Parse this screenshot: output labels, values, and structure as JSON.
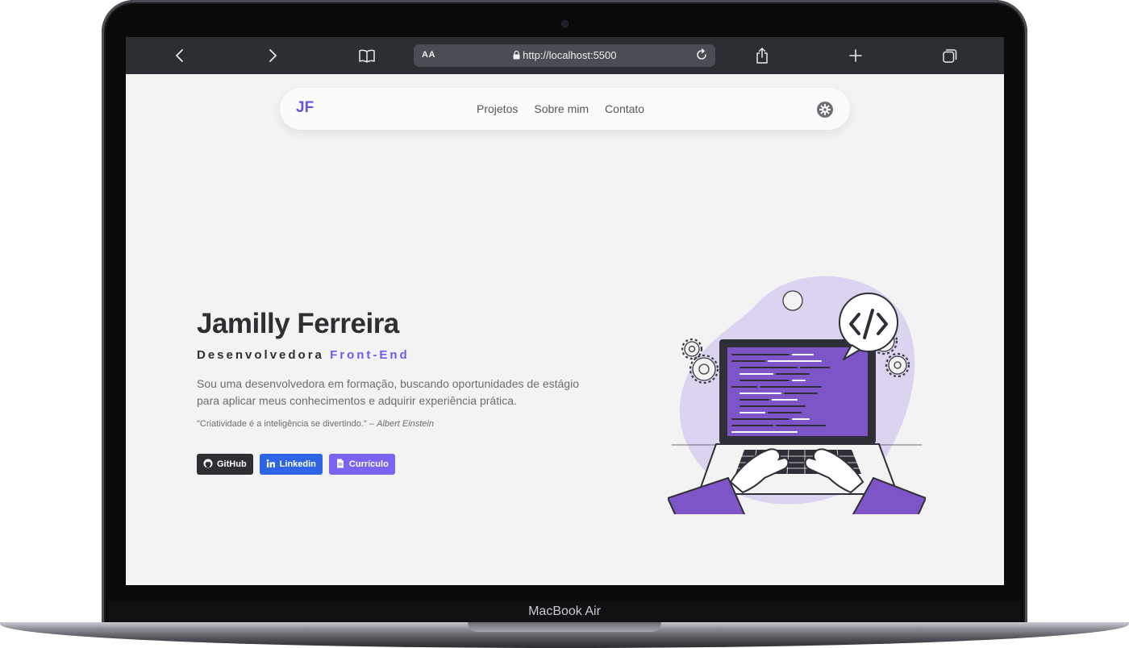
{
  "device": {
    "model_label": "MacBook Air"
  },
  "browser": {
    "text_size_label": "AA",
    "url": "http://localhost:5500",
    "icons": [
      "back-icon",
      "forward-icon",
      "bookmarks-icon",
      "lock-icon",
      "reload-icon",
      "share-icon",
      "new-tab-icon",
      "tabs-icon"
    ]
  },
  "nav": {
    "logo": "JF",
    "links": [
      {
        "label": "Projetos"
      },
      {
        "label": "Sobre mim"
      },
      {
        "label": "Contato"
      }
    ],
    "settings_icon": "gear-icon"
  },
  "hero": {
    "name": "Jamilly Ferreira",
    "role_prefix": "Desenvolvedora",
    "role_accent": "Front-End",
    "description": "Sou uma desenvolvedora em formação, buscando oportunidades de estágio para aplicar meus conhecimentos e adquirir experiência prática.",
    "quote": "\"Criatividade é a inteligência se divertindo.\" –",
    "quote_author": "Albert Einstein",
    "buttons": [
      {
        "label": "GitHub",
        "icon": "github-icon",
        "color": "#2f2f33"
      },
      {
        "label": "Linkedin",
        "icon": "linkedin-icon",
        "color": "#2f64e6"
      },
      {
        "label": "Currículo",
        "icon": "document-icon",
        "color": "#7a63f0"
      }
    ]
  },
  "colors": {
    "accent": "#7657f2",
    "screen_bg": "#f3f3f3",
    "toolbar_bg": "#2b2e33"
  }
}
